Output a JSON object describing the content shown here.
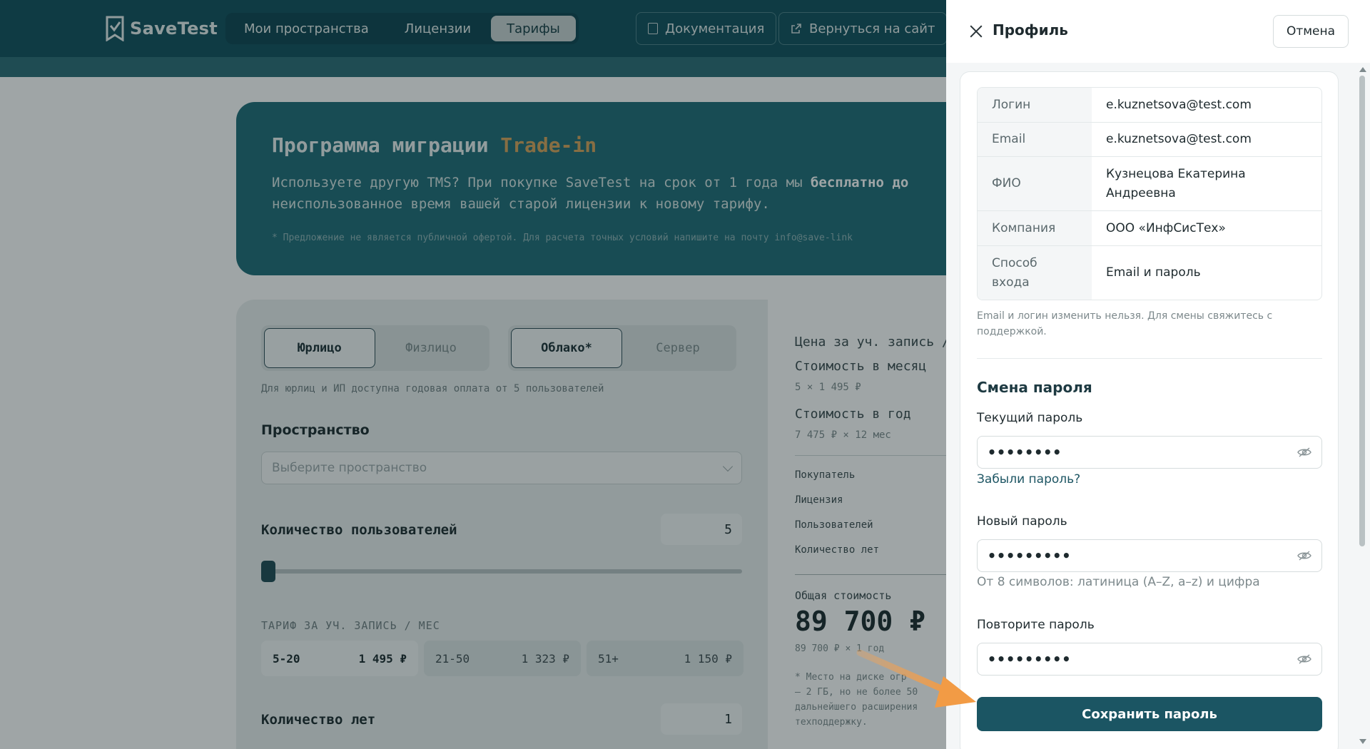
{
  "app": {
    "logo": "SaveTest",
    "nav": [
      {
        "label": "Мои пространства"
      },
      {
        "label": "Лицензии"
      },
      {
        "label": "Тарифы"
      }
    ],
    "docs_button": "Документация",
    "back_button": "Вернуться на сайт"
  },
  "hero": {
    "title_main": "Программа миграции ",
    "title_accent": "Trade-in",
    "text_line1_a": "Используете другую TMS? При покупке SaveTest на срок от 1 года мы ",
    "text_line1_bold": "бесплатно до",
    "text_line2": "неиспользованное время вашей старой лицензии к новому тарифу.",
    "note": "* Предложение не является публичной офертой. Для расчета точных условий напишите на почту info@save-link"
  },
  "calc": {
    "seg_client": [
      "Юрлицо",
      "Физлицо"
    ],
    "seg_host": [
      "Облако*",
      "Сервер"
    ],
    "hint": "Для юрлиц и ИП доступна годовая оплата от 5 пользователей",
    "space_label": "Пространство",
    "space_placeholder": "Выберите пространство",
    "users_label": "Количество пользователей",
    "users_value": "5",
    "tier_label": "ТАРИФ ЗА УЧ. ЗАПИСЬ / МЕС",
    "tiers": [
      {
        "range": "5-20",
        "price": "1 495 ₽"
      },
      {
        "range": "21-50",
        "price": "1 323 ₽"
      },
      {
        "range": "51+",
        "price": "1 150 ₽"
      }
    ],
    "years_label": "Количество лет",
    "years_value": "1"
  },
  "summary": {
    "price_per_user": "Цена за уч. запись /",
    "month_label": "Стоимость в месяц",
    "month_calc": "5 × 1 495 ₽",
    "year_label": "Стоимость в год",
    "year_calc": "7 475 ₽ × 12 мес",
    "buyer": "Покупатель",
    "license": "Лицензия",
    "users": "Пользователей",
    "years": "Количество лет",
    "total_label": "Общая стоимость",
    "total": "89 700 ₽",
    "total_calc": "89 700 ₽ × 1 год",
    "footnote": [
      "* Место на диске огр",
      "– 2 ГБ, но не более 50",
      "дальнейшего расширения",
      "техподдержку."
    ]
  },
  "panel": {
    "title": "Профиль",
    "cancel": "Отмена",
    "info": [
      {
        "key": "Логин",
        "value": "e.kuznetsova@test.com"
      },
      {
        "key": "Email",
        "value": "e.kuznetsova@test.com"
      },
      {
        "key": "ФИО",
        "value": "Кузнецова Екатерина Андреевна"
      },
      {
        "key": "Компания",
        "value": "ООО «ИнфСисТех»"
      },
      {
        "key": "Способ входа",
        "value": "Email и пароль"
      }
    ],
    "help": "Email и логин изменить нельзя. Для смены свяжитесь с поддержкой.",
    "section_title": "Смена пароля",
    "current_label": "Текущий пароль",
    "current_value": "••••••••",
    "forgot": "Забыли пароль?",
    "new_label": "Новый пароль",
    "new_value": "•••••••••",
    "new_hint": "От 8 символов: латиница (A–Z, a–z) и цифра",
    "repeat_label": "Повторите пароль",
    "repeat_value": "•••••••••",
    "save": "Сохранить пароль"
  }
}
